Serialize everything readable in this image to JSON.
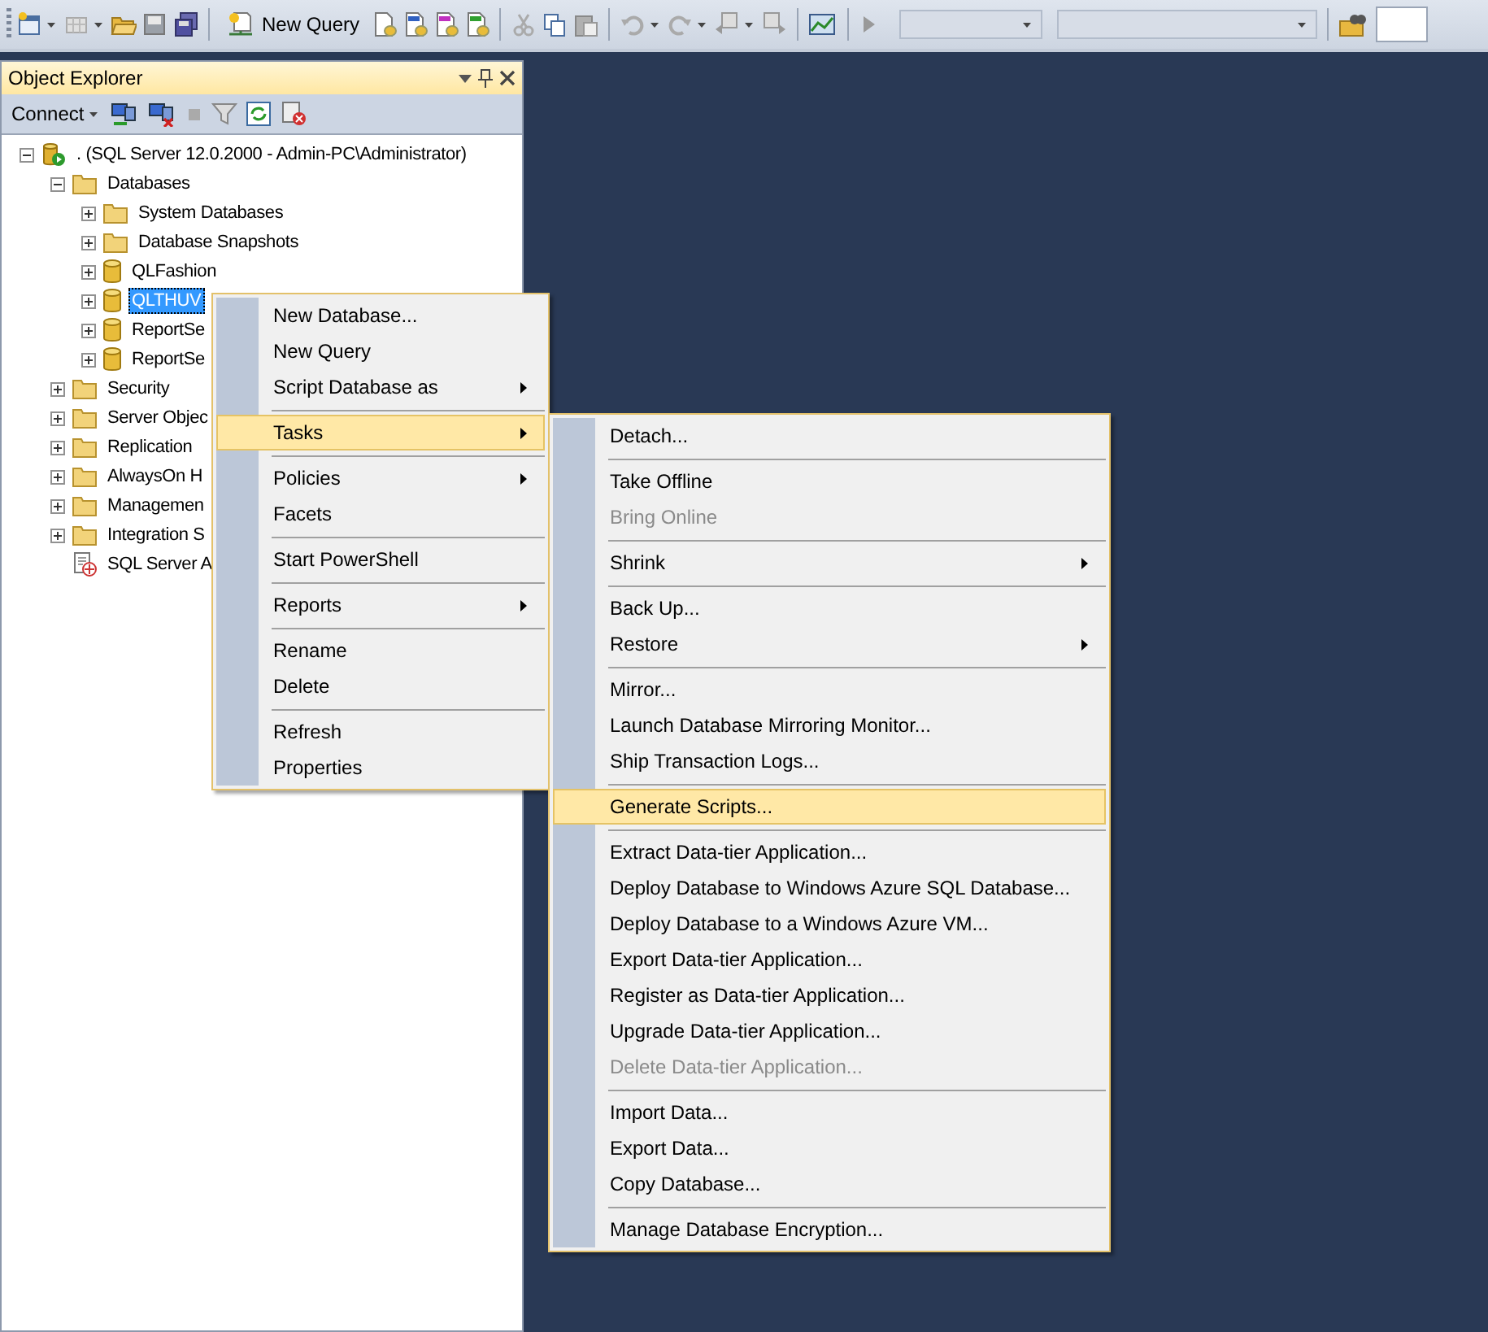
{
  "toolbar": {
    "new_query": "New Query"
  },
  "object_explorer": {
    "title": "Object Explorer",
    "connect": "Connect",
    "tree": [
      {
        "label": ". (SQL Server 12.0.2000 - Admin-PC\\Administrator)",
        "kind": "server",
        "expanded": true,
        "selected": false,
        "children": [
          {
            "label": "Databases",
            "kind": "folder",
            "expanded": true,
            "selected": false,
            "children": [
              {
                "label": "System Databases",
                "kind": "folder",
                "expanded": false,
                "selected": false
              },
              {
                "label": "Database Snapshots",
                "kind": "folder",
                "expanded": false,
                "selected": false
              },
              {
                "label": "QLFashion",
                "kind": "database",
                "expanded": false,
                "selected": false
              },
              {
                "label": "QLTHUV",
                "kind": "database",
                "expanded": false,
                "selected": true
              },
              {
                "label": "ReportSe",
                "kind": "database",
                "expanded": false,
                "selected": false
              },
              {
                "label": "ReportSe",
                "kind": "database",
                "expanded": false,
                "selected": false
              }
            ]
          },
          {
            "label": "Security",
            "kind": "folder",
            "expanded": false,
            "selected": false
          },
          {
            "label": "Server Objec",
            "kind": "folder",
            "expanded": false,
            "selected": false
          },
          {
            "label": "Replication",
            "kind": "folder",
            "expanded": false,
            "selected": false
          },
          {
            "label": "AlwaysOn H",
            "kind": "folder",
            "expanded": false,
            "selected": false
          },
          {
            "label": "Managemen",
            "kind": "folder",
            "expanded": false,
            "selected": false
          },
          {
            "label": "Integration S",
            "kind": "folder",
            "expanded": false,
            "selected": false
          },
          {
            "label": "SQL Server A",
            "kind": "agent",
            "selected": false
          }
        ]
      }
    ]
  },
  "context_menu": {
    "items": [
      {
        "kind": "item",
        "label": "New Database...",
        "submenu": false,
        "selected": false,
        "disabled": false
      },
      {
        "kind": "item",
        "label": "New Query",
        "submenu": false,
        "selected": false,
        "disabled": false
      },
      {
        "kind": "item",
        "label": "Script Database as",
        "submenu": true,
        "selected": false,
        "disabled": false
      },
      {
        "kind": "separator"
      },
      {
        "kind": "item",
        "label": "Tasks",
        "submenu": true,
        "selected": true,
        "disabled": false
      },
      {
        "kind": "separator"
      },
      {
        "kind": "item",
        "label": "Policies",
        "submenu": true,
        "selected": false,
        "disabled": false
      },
      {
        "kind": "item",
        "label": "Facets",
        "submenu": false,
        "selected": false,
        "disabled": false
      },
      {
        "kind": "separator"
      },
      {
        "kind": "item",
        "label": "Start PowerShell",
        "submenu": false,
        "selected": false,
        "disabled": false
      },
      {
        "kind": "separator"
      },
      {
        "kind": "item",
        "label": "Reports",
        "submenu": true,
        "selected": false,
        "disabled": false
      },
      {
        "kind": "separator"
      },
      {
        "kind": "item",
        "label": "Rename",
        "submenu": false,
        "selected": false,
        "disabled": false
      },
      {
        "kind": "item",
        "label": "Delete",
        "submenu": false,
        "selected": false,
        "disabled": false
      },
      {
        "kind": "separator"
      },
      {
        "kind": "item",
        "label": "Refresh",
        "submenu": false,
        "selected": false,
        "disabled": false
      },
      {
        "kind": "item",
        "label": "Properties",
        "submenu": false,
        "selected": false,
        "disabled": false
      }
    ]
  },
  "tasks_menu": {
    "items": [
      {
        "kind": "item",
        "label": "Detach...",
        "submenu": false,
        "selected": false,
        "disabled": false
      },
      {
        "kind": "separator"
      },
      {
        "kind": "item",
        "label": "Take Offline",
        "submenu": false,
        "selected": false,
        "disabled": false
      },
      {
        "kind": "item",
        "label": "Bring Online",
        "submenu": false,
        "selected": false,
        "disabled": true
      },
      {
        "kind": "separator"
      },
      {
        "kind": "item",
        "label": "Shrink",
        "submenu": true,
        "selected": false,
        "disabled": false
      },
      {
        "kind": "separator"
      },
      {
        "kind": "item",
        "label": "Back Up...",
        "submenu": false,
        "selected": false,
        "disabled": false
      },
      {
        "kind": "item",
        "label": "Restore",
        "submenu": true,
        "selected": false,
        "disabled": false
      },
      {
        "kind": "separator"
      },
      {
        "kind": "item",
        "label": "Mirror...",
        "submenu": false,
        "selected": false,
        "disabled": false
      },
      {
        "kind": "item",
        "label": "Launch Database Mirroring Monitor...",
        "submenu": false,
        "selected": false,
        "disabled": false
      },
      {
        "kind": "item",
        "label": "Ship Transaction Logs...",
        "submenu": false,
        "selected": false,
        "disabled": false
      },
      {
        "kind": "separator"
      },
      {
        "kind": "item",
        "label": "Generate Scripts...",
        "submenu": false,
        "selected": true,
        "disabled": false
      },
      {
        "kind": "separator"
      },
      {
        "kind": "item",
        "label": "Extract Data-tier Application...",
        "submenu": false,
        "selected": false,
        "disabled": false
      },
      {
        "kind": "item",
        "label": "Deploy Database to Windows Azure SQL Database...",
        "submenu": false,
        "selected": false,
        "disabled": false
      },
      {
        "kind": "item",
        "label": "Deploy Database to a Windows Azure VM...",
        "submenu": false,
        "selected": false,
        "disabled": false
      },
      {
        "kind": "item",
        "label": "Export Data-tier Application...",
        "submenu": false,
        "selected": false,
        "disabled": false
      },
      {
        "kind": "item",
        "label": "Register as Data-tier Application...",
        "submenu": false,
        "selected": false,
        "disabled": false
      },
      {
        "kind": "item",
        "label": "Upgrade Data-tier Application...",
        "submenu": false,
        "selected": false,
        "disabled": false
      },
      {
        "kind": "item",
        "label": "Delete Data-tier Application...",
        "submenu": false,
        "selected": false,
        "disabled": true
      },
      {
        "kind": "separator"
      },
      {
        "kind": "item",
        "label": "Import Data...",
        "submenu": false,
        "selected": false,
        "disabled": false
      },
      {
        "kind": "item",
        "label": "Export Data...",
        "submenu": false,
        "selected": false,
        "disabled": false
      },
      {
        "kind": "item",
        "label": "Copy Database...",
        "submenu": false,
        "selected": false,
        "disabled": false
      },
      {
        "kind": "separator"
      },
      {
        "kind": "item",
        "label": "Manage Database Encryption...",
        "submenu": false,
        "selected": false,
        "disabled": false
      }
    ]
  }
}
